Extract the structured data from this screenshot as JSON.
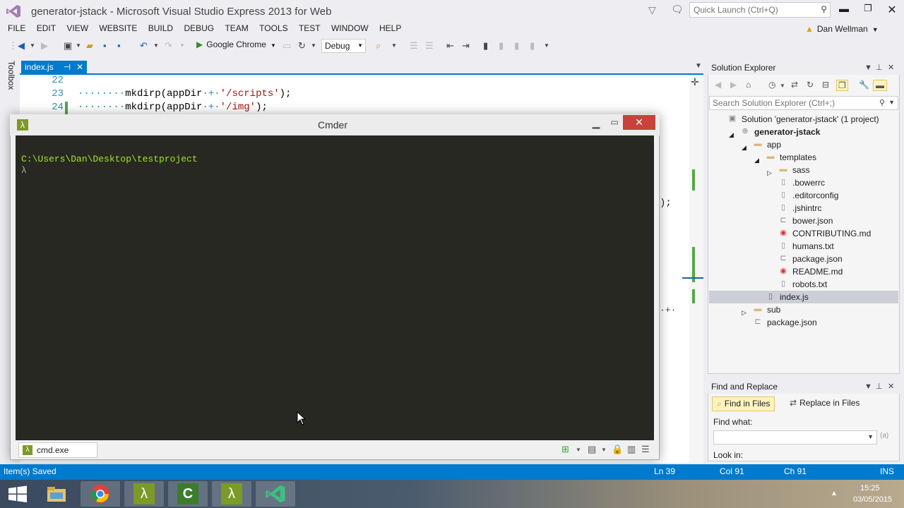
{
  "window": {
    "title": "generator-jstack - Microsoft Visual Studio Express 2013 for Web"
  },
  "quick_launch": {
    "placeholder": "Quick Launch (Ctrl+Q)"
  },
  "menu": [
    "FILE",
    "EDIT",
    "VIEW",
    "WEBSITE",
    "BUILD",
    "DEBUG",
    "TEAM",
    "TOOLS",
    "TEST",
    "WINDOW",
    "HELP"
  ],
  "user": {
    "name": "Dan Wellman"
  },
  "toolbar": {
    "run_target": "Google Chrome",
    "configuration": "Debug"
  },
  "toolbox": {
    "label": "Toolbox"
  },
  "editor": {
    "tab": "index.js",
    "lines": [
      {
        "num": "22",
        "dots": "",
        "call": "",
        "arg": "",
        "str": "",
        "end": ""
      },
      {
        "num": "23",
        "dots": "········",
        "call": "mkdirp(appDir",
        "arg": "·+·",
        "str": "'/scripts'",
        "end": ");"
      },
      {
        "num": "24",
        "dots": "········",
        "call": "mkdirp(appDir",
        "arg": "·+·",
        "str": "'/img'",
        "end": ");"
      }
    ],
    "peek_text_1": ");",
    "peek_text_2": "·+·"
  },
  "cmder": {
    "title": "Cmder",
    "path": "C:\\Users\\Dan\\Desktop\\testproject",
    "prompt": "λ",
    "tab_label": "cmd.exe"
  },
  "solution_explorer": {
    "title": "Solution Explorer",
    "search_placeholder": "Search Solution Explorer (Ctrl+;)",
    "tree": [
      {
        "label": "Solution 'generator-jstack' (1 project)",
        "icon": "solution-icon",
        "depth": 0,
        "arrow": ""
      },
      {
        "label": "generator-jstack",
        "icon": "globe-project-icon",
        "depth": 1,
        "arrow": "expanded"
      },
      {
        "label": "app",
        "icon": "folder-icon",
        "depth": 2,
        "arrow": "expanded"
      },
      {
        "label": "templates",
        "icon": "folder-icon",
        "depth": 3,
        "arrow": "expanded"
      },
      {
        "label": "sass",
        "icon": "folder-icon",
        "depth": 4,
        "arrow": "collapsed"
      },
      {
        "label": ".bowerrc",
        "icon": "file-icon",
        "depth": 4,
        "arrow": ""
      },
      {
        "label": ".editorconfig",
        "icon": "file-icon",
        "depth": 4,
        "arrow": ""
      },
      {
        "label": ".jshintrc",
        "icon": "file-icon",
        "depth": 4,
        "arrow": ""
      },
      {
        "label": "bower.json",
        "icon": "json-file-icon",
        "depth": 4,
        "arrow": ""
      },
      {
        "label": "CONTRIBUTING.md",
        "icon": "chrome-file-icon",
        "depth": 4,
        "arrow": ""
      },
      {
        "label": "humans.txt",
        "icon": "text-file-icon",
        "depth": 4,
        "arrow": ""
      },
      {
        "label": "package.json",
        "icon": "json-file-icon",
        "depth": 4,
        "arrow": ""
      },
      {
        "label": "README.md",
        "icon": "chrome-file-icon",
        "depth": 4,
        "arrow": ""
      },
      {
        "label": "robots.txt",
        "icon": "text-file-icon",
        "depth": 4,
        "arrow": ""
      },
      {
        "label": "index.js",
        "icon": "js-file-icon",
        "depth": 3,
        "arrow": "",
        "selected": true
      },
      {
        "label": "sub",
        "icon": "folder-icon",
        "depth": 2,
        "arrow": "collapsed"
      },
      {
        "label": "package.json",
        "icon": "json-file-icon",
        "depth": 2,
        "arrow": ""
      }
    ]
  },
  "find_replace": {
    "title": "Find and Replace",
    "tab_find": "Find in Files",
    "tab_replace": "Replace in Files",
    "find_what_label": "Find what:",
    "look_in_label": "Look in:"
  },
  "status": {
    "message": "Item(s) Saved",
    "ln": "Ln 39",
    "col": "Col 91",
    "ch": "Ch 91",
    "mode": "INS"
  },
  "taskbar": {
    "time": "15:25",
    "date": "03/05/2015",
    "items": [
      "file-explorer-icon",
      "chrome-icon",
      "cmder-icon",
      "camtasia-icon",
      "cmder-icon",
      "visual-studio-icon"
    ]
  },
  "colors": {
    "accent": "#007acc",
    "cmder_green": "#7c9a27",
    "console_bg": "#272822",
    "console_path": "#a6e22e"
  }
}
